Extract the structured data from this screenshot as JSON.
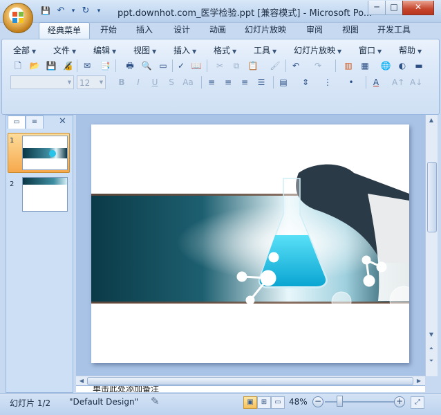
{
  "titlebar": {
    "title": "ppt.downhot.com_医学检验.ppt [兼容模式] - Microsoft Po...",
    "minimize": "─",
    "maximize": "□",
    "close": "✕"
  },
  "quick_access": {
    "save": "💾",
    "undo": "↶",
    "undo_dropdown": "▾",
    "redo": "↻",
    "customize": "▾"
  },
  "ribbon_tabs": [
    "经典菜单",
    "开始",
    "插入",
    "设计",
    "动画",
    "幻灯片放映",
    "审阅",
    "视图",
    "开发工具"
  ],
  "active_tab": "经典菜单",
  "classic_menu": [
    "全部",
    "文件",
    "编辑",
    "视图",
    "插入",
    "格式",
    "工具",
    "幻灯片放映",
    "窗口",
    "帮助"
  ],
  "format_bar": {
    "font_name": "",
    "font_size": "12"
  },
  "panel": {
    "tab_slides_icon": "▭",
    "tab_outline_icon": "≡",
    "close": "✕",
    "slides": [
      {
        "number": "1",
        "selected": true
      },
      {
        "number": "2",
        "selected": false
      }
    ]
  },
  "notes_placeholder": "单击此处添加备注",
  "status": {
    "slide_info": "幻灯片 1/2",
    "theme": "\"Default Design\"",
    "zoom": "48%",
    "zoom_level": 0.48
  },
  "colors": {
    "ribbon_bg": "#dbe8f8",
    "accent_teal": "#1fb3d6",
    "slide_band": "#0c3d4c",
    "selection": "#f6a84c"
  }
}
